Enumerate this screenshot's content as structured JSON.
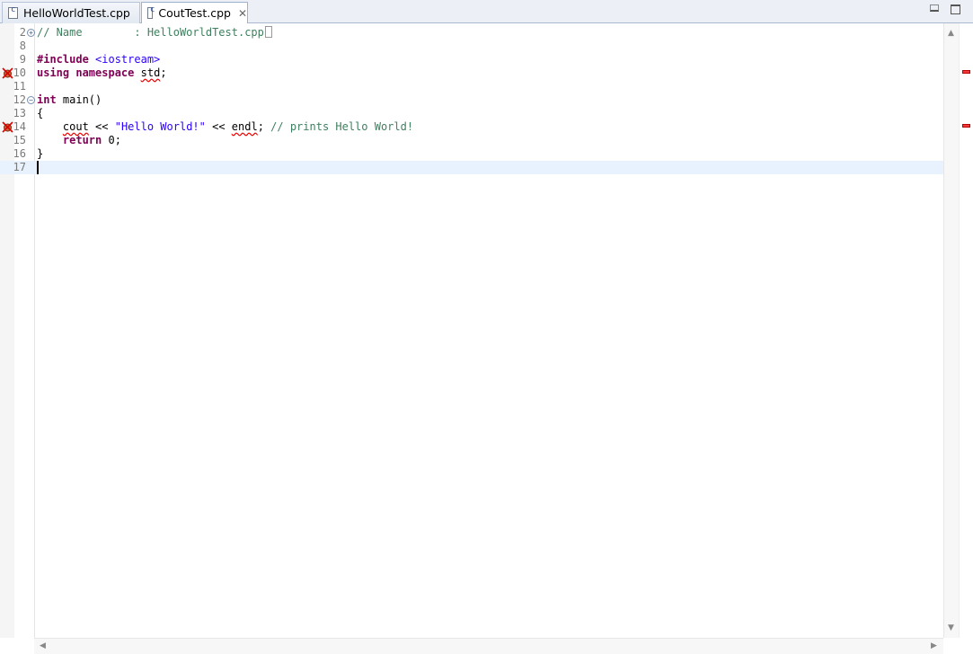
{
  "tabs": [
    {
      "label": "HelloWorldTest.cpp",
      "icon": "cpp-file-icon",
      "active": false
    },
    {
      "label": "CoutTest.cpp",
      "icon": "cpp-file-icon",
      "active": true,
      "close_icon": "close-icon"
    }
  ],
  "window_controls": {
    "minimize": "minimize-icon",
    "maximize": "maximize-icon"
  },
  "editor": {
    "lines": [
      {
        "num": "2",
        "tokens": [
          {
            "t": "// Name        : HelloWorldTest.cpp",
            "c": "cmt"
          }
        ]
      },
      {
        "num": "8",
        "tokens": []
      },
      {
        "num": "9",
        "tokens": [
          {
            "t": "#include",
            "c": "kw"
          },
          {
            "t": " ",
            "c": ""
          },
          {
            "t": "<iostream>",
            "c": "inc"
          }
        ]
      },
      {
        "num": "10",
        "tokens": [
          {
            "t": "using",
            "c": "kw"
          },
          {
            "t": " ",
            "c": ""
          },
          {
            "t": "namespace",
            "c": "kw"
          },
          {
            "t": " ",
            "c": ""
          },
          {
            "t": "std",
            "c": "err"
          },
          {
            "t": ";",
            "c": ""
          }
        ]
      },
      {
        "num": "11",
        "tokens": []
      },
      {
        "num": "12",
        "tokens": [
          {
            "t": "int",
            "c": "kw"
          },
          {
            "t": " main()",
            "c": ""
          }
        ]
      },
      {
        "num": "13",
        "tokens": [
          {
            "t": "{",
            "c": ""
          }
        ]
      },
      {
        "num": "14",
        "tokens": [
          {
            "t": "    ",
            "c": ""
          },
          {
            "t": "cout",
            "c": "err"
          },
          {
            "t": " << ",
            "c": ""
          },
          {
            "t": "\"Hello World!\"",
            "c": "str"
          },
          {
            "t": " << ",
            "c": ""
          },
          {
            "t": "endl",
            "c": "err"
          },
          {
            "t": "; ",
            "c": ""
          },
          {
            "t": "// prints Hello World!",
            "c": "cmt"
          }
        ]
      },
      {
        "num": "15",
        "tokens": [
          {
            "t": "    ",
            "c": ""
          },
          {
            "t": "return",
            "c": "kw"
          },
          {
            "t": " 0;",
            "c": ""
          }
        ]
      },
      {
        "num": "16",
        "tokens": [
          {
            "t": "}",
            "c": ""
          }
        ]
      },
      {
        "num": "17",
        "tokens": []
      }
    ]
  },
  "colors": {
    "error": "#e00000",
    "current_line": "#e8f2fe",
    "keyword": "#7f0055",
    "comment": "#3f7f5f",
    "string": "#2a00ff"
  }
}
